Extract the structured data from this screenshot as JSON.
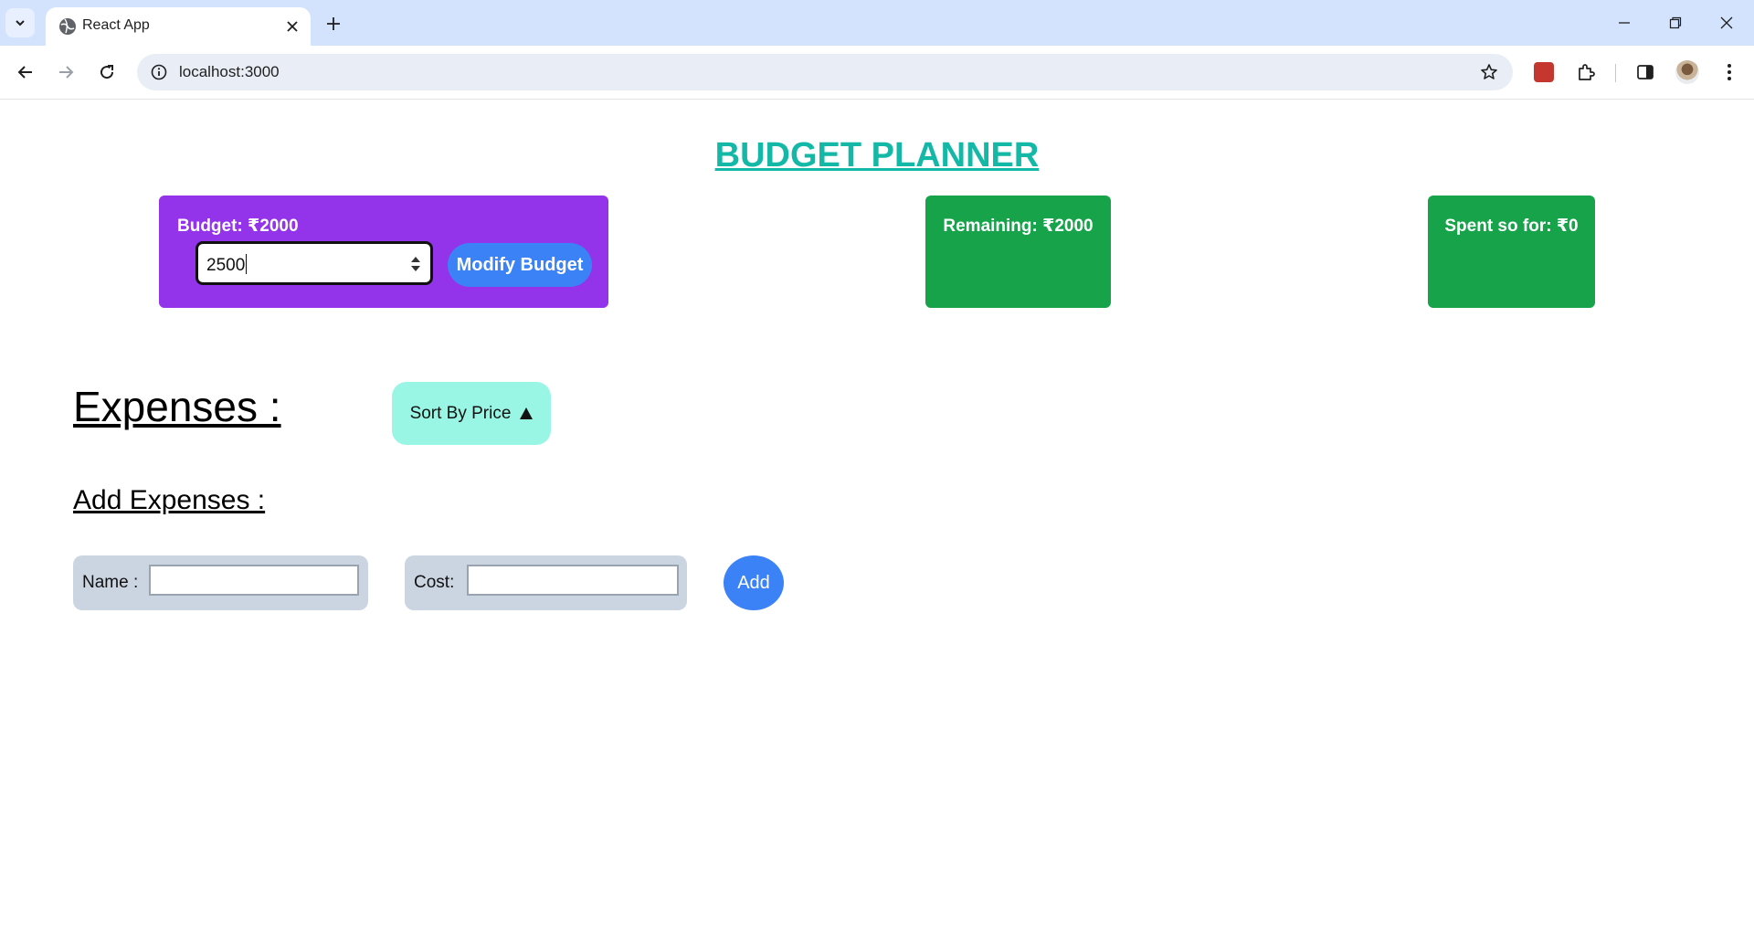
{
  "browser": {
    "tab_title": "React App",
    "url": "localhost:3000"
  },
  "app": {
    "title": "BUDGET PLANNER",
    "budget": {
      "label": "Budget: ₹2000",
      "input_value": "2500",
      "modify_button": "Modify Budget"
    },
    "remaining": "Remaining: ₹2000",
    "spent": "Spent so for: ₹0",
    "expenses_heading": "Expenses :",
    "sort_button": "Sort By Price",
    "add_expenses_heading": "Add Expenses :",
    "form": {
      "name_label": "Name :",
      "name_value": "",
      "cost_label": "Cost:",
      "cost_value": "",
      "add_button": "Add"
    }
  },
  "colors": {
    "title": "#14b8a6",
    "budget_card": "#9333ea",
    "status_card": "#16a34a",
    "primary_button": "#3b82f6",
    "sort_button": "#99f6e4",
    "form_box": "#cbd5e1"
  }
}
